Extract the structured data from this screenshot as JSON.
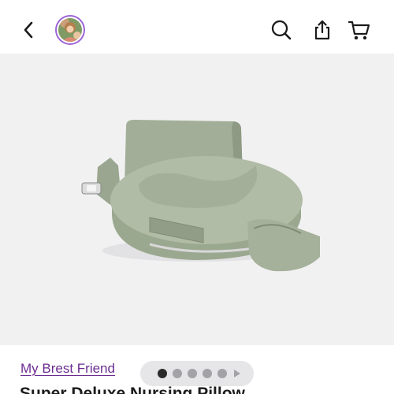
{
  "header": {
    "icons": {
      "back": "chevron-left-icon",
      "search": "search-icon",
      "share": "share-icon",
      "cart": "cart-icon"
    }
  },
  "gallery": {
    "image_count": 5,
    "active_index": 0,
    "background_color": "#f1f1f2"
  },
  "product": {
    "brand": "My Brest Friend",
    "title": "Super Deluxe Nursing Pillow"
  },
  "colors": {
    "brand_link": "#6b2c91",
    "avatar_ring": "#9c64d8",
    "pillow": "#a9b5a0"
  }
}
